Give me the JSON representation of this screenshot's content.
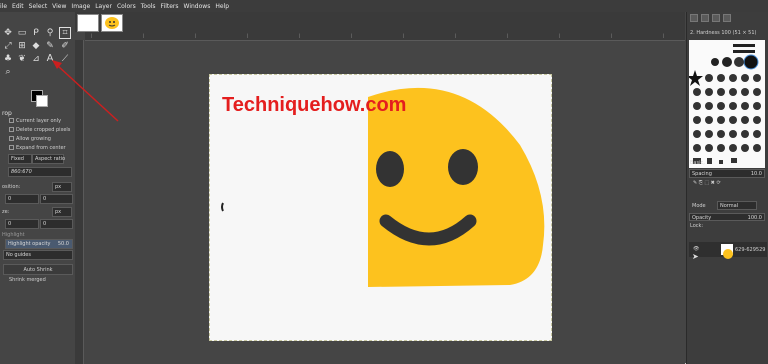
{
  "menubar": [
    "ile",
    "Edit",
    "Select",
    "View",
    "Image",
    "Layer",
    "Colors",
    "Tools",
    "Filters",
    "Windows",
    "Help"
  ],
  "tool_options": {
    "title": "rop",
    "checkboxes": [
      "Current layer only",
      "Delete cropped pixels",
      "Allow growing",
      "Expand from center"
    ],
    "fixed_label": "Fixed",
    "fixed_value": "Aspect ratio",
    "ratio_value": "860:670",
    "position_label": "osition:",
    "position_unit": "px",
    "position_x": "0",
    "position_y": "0",
    "size_label": "ze:",
    "size_unit": "px",
    "size_w": "0",
    "size_h": "0",
    "highlight_label": "Highlight",
    "highlight_opacity_label": "Highlight opacity",
    "highlight_opacity_value": "50.0",
    "guides_value": "No guides",
    "auto_shrink": "Auto Shrink",
    "shrink_merged": "Shrink merged"
  },
  "watermark": "Techniquehow.com",
  "brushes": {
    "name": "2. Hardness 100 (51 × 51)",
    "preset": "Basic,",
    "spacing_label": "Spacing",
    "spacing_value": "10.0"
  },
  "layers": {
    "mode_label": "Mode",
    "mode_value": "Normal",
    "opacity_label": "Opacity",
    "opacity_value": "100.0",
    "lock_label": "Lock:",
    "layer_name": "629-629529"
  },
  "colors": {
    "accent": "#e41e1e",
    "emoji": "#fdc21e",
    "eyes": "#333333",
    "background": "#454545"
  }
}
